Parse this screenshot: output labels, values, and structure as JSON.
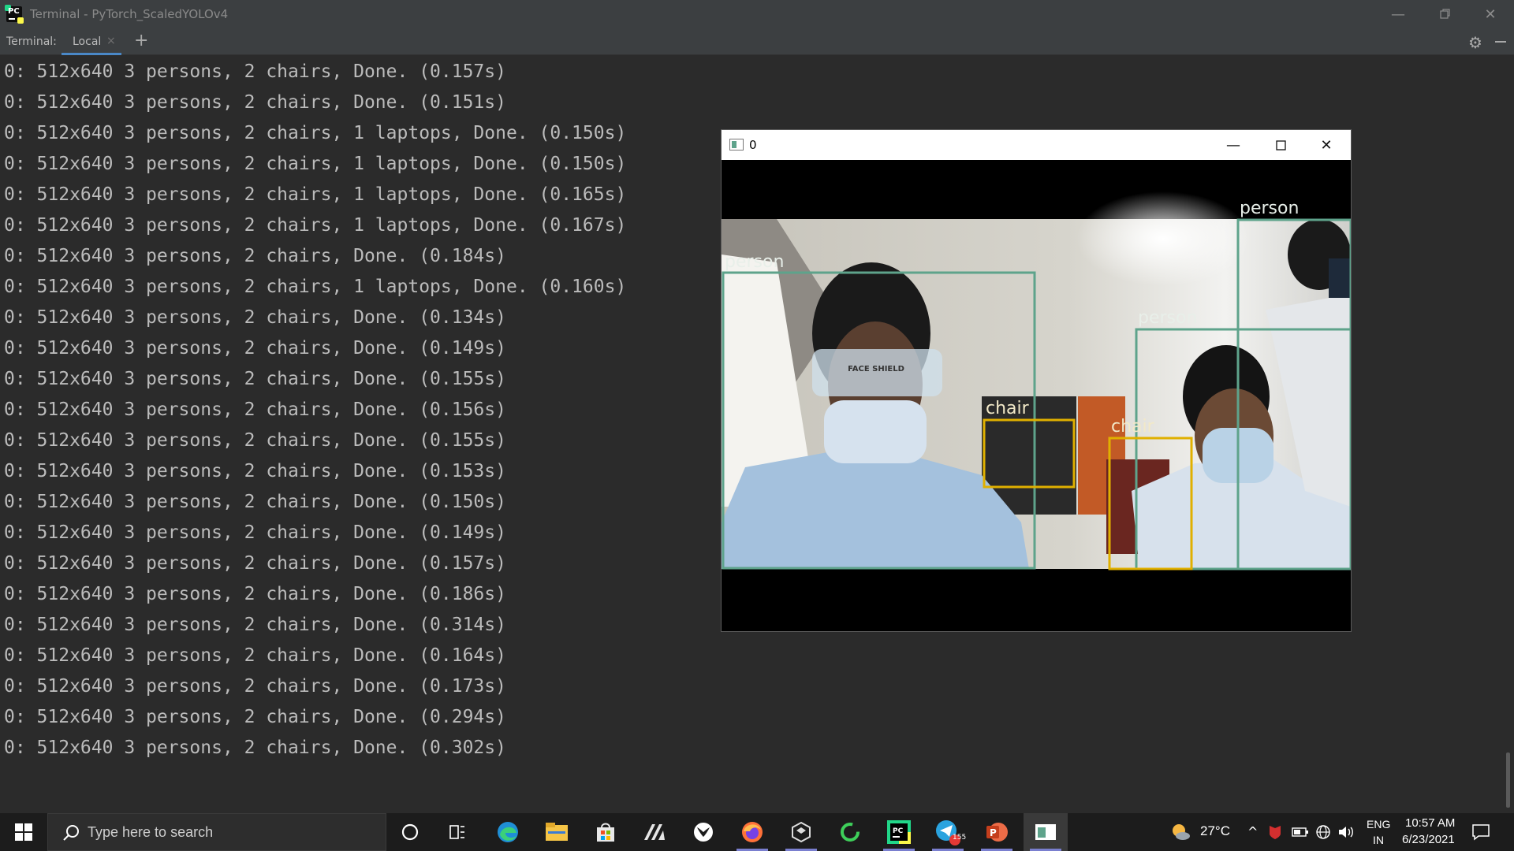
{
  "window": {
    "title": "Terminal - PyTorch_ScaledYOLOv4",
    "minimize_icon": "minimize-icon",
    "restore_icon": "restore-icon",
    "close_icon": "close-icon"
  },
  "toolwindow": {
    "label": "Terminal:",
    "tab_label": "Local",
    "tab_close_icon": "close-icon",
    "add_icon": "plus-icon",
    "settings_icon": "gear-icon",
    "hide_icon": "minus-icon"
  },
  "terminal": {
    "lines": [
      "0: 512x640 3 persons, 2 chairs, Done. (0.157s)",
      "0: 512x640 3 persons, 2 chairs, Done. (0.151s)",
      "0: 512x640 3 persons, 2 chairs, 1 laptops, Done. (0.150s)",
      "0: 512x640 3 persons, 2 chairs, 1 laptops, Done. (0.150s)",
      "0: 512x640 3 persons, 2 chairs, 1 laptops, Done. (0.165s)",
      "0: 512x640 3 persons, 2 chairs, 1 laptops, Done. (0.167s)",
      "0: 512x640 3 persons, 2 chairs, Done. (0.184s)",
      "0: 512x640 3 persons, 2 chairs, 1 laptops, Done. (0.160s)",
      "0: 512x640 3 persons, 2 chairs, Done. (0.134s)",
      "0: 512x640 3 persons, 2 chairs, Done. (0.149s)",
      "0: 512x640 3 persons, 2 chairs, Done. (0.155s)",
      "0: 512x640 3 persons, 2 chairs, Done. (0.156s)",
      "0: 512x640 3 persons, 2 chairs, Done. (0.155s)",
      "0: 512x640 3 persons, 2 chairs, Done. (0.153s)",
      "0: 512x640 3 persons, 2 chairs, Done. (0.150s)",
      "0: 512x640 3 persons, 2 chairs, Done. (0.149s)",
      "0: 512x640 3 persons, 2 chairs, Done. (0.157s)",
      "0: 512x640 3 persons, 2 chairs, Done. (0.186s)",
      "0: 512x640 3 persons, 2 chairs, Done. (0.314s)",
      "0: 512x640 3 persons, 2 chairs, Done. (0.164s)",
      "0: 512x640 3 persons, 2 chairs, Done. (0.173s)",
      "0: 512x640 3 persons, 2 chairs, Done. (0.294s)",
      "0: 512x640 3 persons, 2 chairs, Done. (0.302s)"
    ]
  },
  "cv_window": {
    "title": "0",
    "detections": [
      {
        "label": "person",
        "color": "#5ea38b"
      },
      {
        "label": "person",
        "color": "#5ea38b"
      },
      {
        "label": "person",
        "color": "#5ea38b"
      },
      {
        "label": "chair",
        "color": "#e0b000"
      },
      {
        "label": "chair",
        "color": "#e0b000"
      }
    ],
    "face_shield_text": "FACE SHIELD"
  },
  "taskbar": {
    "search_placeholder": "Type here to search",
    "weather": "27°C",
    "telegram_badge": "155",
    "lang_top": "ENG",
    "lang_bottom": "IN",
    "time": "10:57 AM",
    "date": "6/23/2021",
    "icons": [
      "windows-start-icon",
      "cortana-icon",
      "task-view-icon",
      "edge-icon",
      "file-explorer-icon",
      "store-icon",
      "app-icon",
      "xbox-icon",
      "firefox-icon",
      "unity-icon",
      "circle-app-icon",
      "pycharm-icon",
      "telegram-icon",
      "powerpoint-icon",
      "opencv-window-icon"
    ]
  }
}
